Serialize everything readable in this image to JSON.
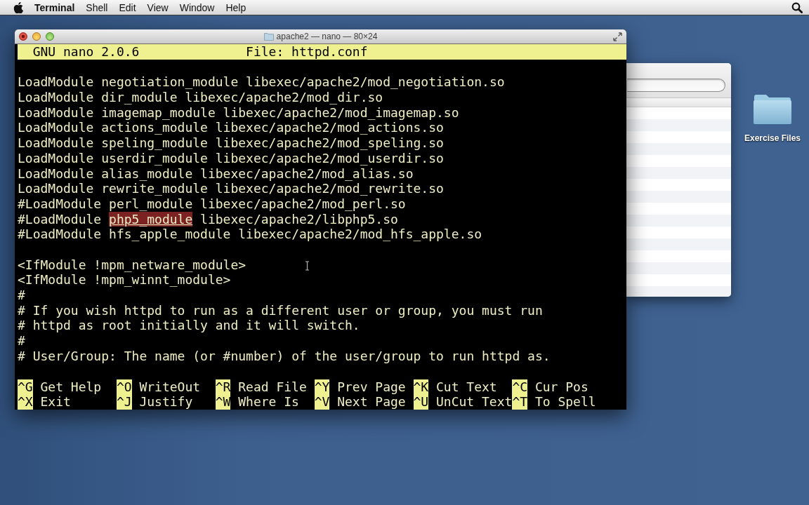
{
  "menu_bar": {
    "app_name": "Terminal",
    "menus": [
      "Shell",
      "Edit",
      "View",
      "Window",
      "Help"
    ]
  },
  "terminal_window": {
    "title": "apache2 — nano — 80×24",
    "nano": {
      "header": {
        "version": "GNU nano 2.0.6",
        "file": "File: httpd.conf"
      },
      "blocks": [
        {
          "lines": [
            [
              {
                "text": "LoadModule negotiation_module libexec/apache2/mod_negotiation.so",
                "highlighted": false
              }
            ],
            [
              {
                "text": "LoadModule dir_module libexec/apache2/mod_dir.so",
                "highlighted": false
              }
            ],
            [
              {
                "text": "LoadModule imagemap_module libexec/apache2/mod_imagemap.so",
                "highlighted": false
              }
            ],
            [
              {
                "text": "LoadModule actions_module libexec/apache2/mod_actions.so",
                "highlighted": false
              }
            ],
            [
              {
                "text": "LoadModule speling_module libexec/apache2/mod_speling.so",
                "highlighted": false
              }
            ],
            [
              {
                "text": "LoadModule userdir_module libexec/apache2/mod_userdir.so",
                "highlighted": false
              }
            ],
            [
              {
                "text": "LoadModule alias_module libexec/apache2/mod_alias.so",
                "highlighted": false
              }
            ],
            [
              {
                "text": "LoadModule rewrite_module libexec/apache2/mod_rewrite.so",
                "highlighted": false
              }
            ],
            [
              {
                "text": "#LoadModule perl_module libexec/apache2/mod_perl.so",
                "highlighted": false
              }
            ],
            [
              {
                "text": "#LoadModule ",
                "highlighted": false
              },
              {
                "text": "php5_module",
                "highlighted": true
              },
              {
                "text": " libexec/apache2/libphp5.so",
                "highlighted": false
              }
            ],
            [
              {
                "text": "#LoadModule hfs_apple_module libexec/apache2/mod_hfs_apple.so",
                "highlighted": false
              }
            ]
          ]
        },
        {
          "lines": [
            [
              {
                "text": "<IfModule !mpm_netware_module>",
                "highlighted": false
              }
            ],
            [
              {
                "text": "<IfModule !mpm_winnt_module>",
                "highlighted": false
              }
            ],
            [
              {
                "text": "#",
                "highlighted": false
              }
            ],
            [
              {
                "text": "# If you wish httpd to run as a different user or group, you must run",
                "highlighted": false
              }
            ],
            [
              {
                "text": "# httpd as root initially and it will switch.",
                "highlighted": false
              }
            ],
            [
              {
                "text": "#",
                "highlighted": false
              }
            ],
            [
              {
                "text": "# User/Group: The name (or #number) of the user/group to run httpd as.",
                "highlighted": false
              }
            ]
          ]
        }
      ],
      "shortcut_rows": [
        {
          "shortcuts": [
            {
              "key": "^G",
              "label": "Get Help"
            },
            {
              "key": "^O",
              "label": "WriteOut"
            },
            {
              "key": "^R",
              "label": "Read File"
            },
            {
              "key": "^Y",
              "label": "Prev Page"
            },
            {
              "key": "^K",
              "label": "Cut Text"
            },
            {
              "key": "^C",
              "label": "Cur Pos"
            }
          ]
        },
        {
          "shortcuts": [
            {
              "key": "^X",
              "label": "Exit"
            },
            {
              "key": "^J",
              "label": "Justify"
            },
            {
              "key": "^W",
              "label": "Where Is"
            },
            {
              "key": "^V",
              "label": "Next Page"
            },
            {
              "key": "^U",
              "label": "UnCut Text"
            },
            {
              "key": "^T",
              "label": "To Spell"
            }
          ]
        }
      ]
    }
  },
  "desktop_items": [
    {
      "label": "Exercise Files"
    }
  ]
}
